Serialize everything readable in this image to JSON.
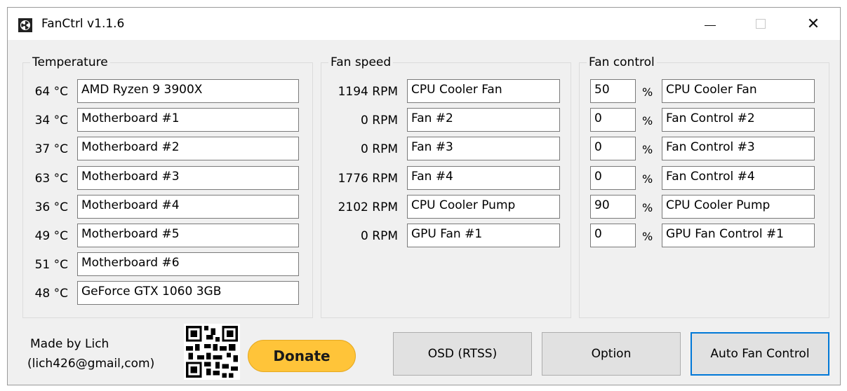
{
  "window": {
    "title": "FanCtrl v1.1.6",
    "icon": "fan-icon",
    "minimize_icon": "minimize-icon",
    "maximize_icon": "maximize-icon",
    "close_icon": "close-icon",
    "close_glyph": "✕"
  },
  "temperature": {
    "title": "Temperature",
    "rows": [
      {
        "value": "64 °C",
        "name": "AMD Ryzen 9 3900X"
      },
      {
        "value": "34 °C",
        "name": "Motherboard #1"
      },
      {
        "value": "37 °C",
        "name": "Motherboard #2"
      },
      {
        "value": "63 °C",
        "name": "Motherboard #3"
      },
      {
        "value": "36 °C",
        "name": "Motherboard #4"
      },
      {
        "value": "49 °C",
        "name": "Motherboard #5"
      },
      {
        "value": "51 °C",
        "name": "Motherboard #6"
      },
      {
        "value": "48 °C",
        "name": "GeForce GTX 1060 3GB"
      }
    ]
  },
  "fan_speed": {
    "title": "Fan speed",
    "rows": [
      {
        "value": "1194 RPM",
        "name": "CPU Cooler Fan"
      },
      {
        "value": "0 RPM",
        "name": "Fan #2"
      },
      {
        "value": "0 RPM",
        "name": "Fan #3"
      },
      {
        "value": "1776 RPM",
        "name": "Fan #4"
      },
      {
        "value": "2102 RPM",
        "name": "CPU Cooler Pump"
      },
      {
        "value": "0 RPM",
        "name": "GPU Fan #1"
      }
    ]
  },
  "fan_control": {
    "title": "Fan control",
    "unit": "%",
    "rows": [
      {
        "value": "50",
        "name": "CPU Cooler Fan"
      },
      {
        "value": "0",
        "name": "Fan Control #2"
      },
      {
        "value": "0",
        "name": "Fan Control #3"
      },
      {
        "value": "0",
        "name": "Fan Control #4"
      },
      {
        "value": "90",
        "name": "CPU Cooler Pump"
      },
      {
        "value": "0",
        "name": "GPU Fan Control #1"
      }
    ]
  },
  "footer": {
    "credit_line1": "Made by Lich",
    "credit_line2": "(lich426@gmail,com)",
    "qr_icon": "qr-code-icon",
    "donate_label": "Donate",
    "osd_label": "OSD (RTSS)",
    "option_label": "Option",
    "auto_label": "Auto Fan Control"
  },
  "colors": {
    "accent": "#0078d7",
    "donate": "#ffc439",
    "background": "#f0f0f0"
  }
}
